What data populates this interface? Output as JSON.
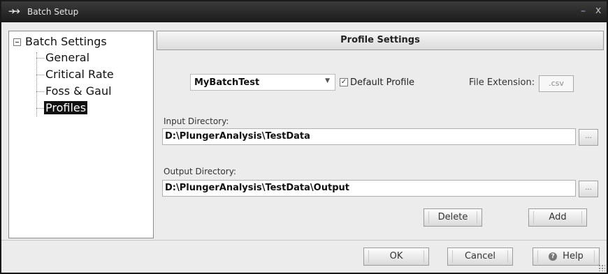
{
  "window": {
    "title": "Batch Setup",
    "minimize_glyph": "–",
    "close_glyph": "x"
  },
  "tree": {
    "root_label": "Batch Settings",
    "items": [
      {
        "label": "General"
      },
      {
        "label": "Critical Rate"
      },
      {
        "label": "Foss & Gaul"
      },
      {
        "label": "Profiles",
        "selected": true
      }
    ]
  },
  "panel": {
    "header": "Profile Settings",
    "profile_value": "MyBatchTest",
    "default_profile_label": "Default Profile",
    "default_profile_checked": true,
    "file_extension_label": "File Extension:",
    "file_extension_value": ".csv",
    "input_dir_label": "Input Directory:",
    "input_dir_value": "D:\\PlungerAnalysis\\TestData",
    "output_dir_label": "Output Directory:",
    "output_dir_value": "D:\\PlungerAnalysis\\TestData\\Output",
    "browse_label": "...",
    "delete_label": "Delete",
    "add_label": "Add"
  },
  "footer": {
    "ok_label": "OK",
    "cancel_label": "Cancel",
    "help_label": "Help"
  },
  "icons": {
    "window": "arrows-icon",
    "help": "help-icon",
    "dropdown": "chevron-down-icon"
  }
}
